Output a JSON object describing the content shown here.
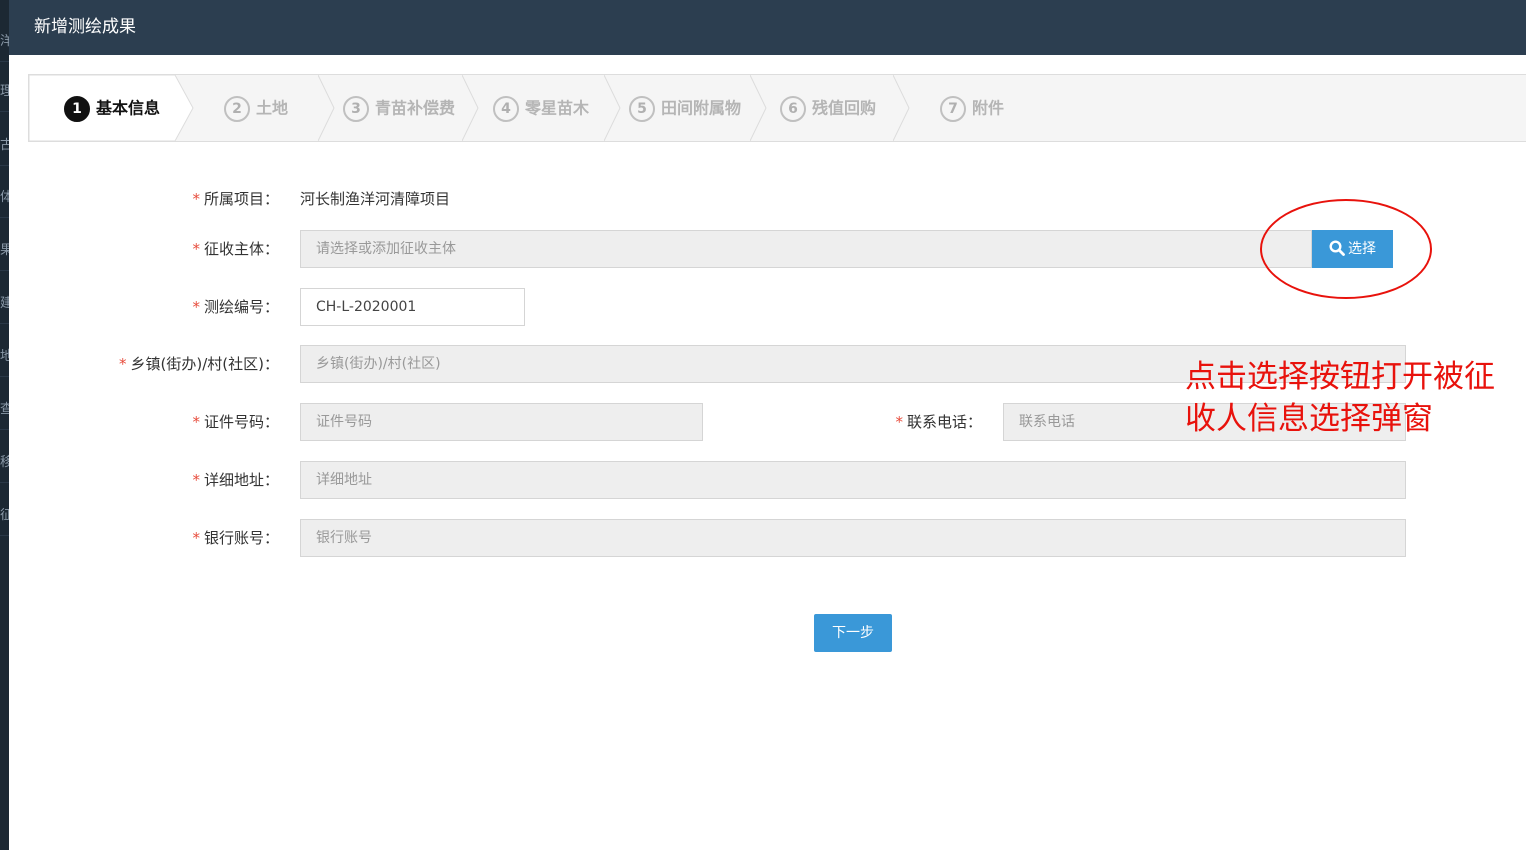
{
  "background": {
    "sidebar_fragments": [
      "洋",
      "理",
      "古",
      "体",
      "果",
      "建",
      "地",
      "查",
      "移",
      "征"
    ]
  },
  "modal": {
    "title": "新增测绘成果"
  },
  "steps": [
    {
      "number": "1",
      "label": "基本信息",
      "active": true
    },
    {
      "number": "2",
      "label": "土地",
      "active": false
    },
    {
      "number": "3",
      "label": "青苗补偿费",
      "active": false
    },
    {
      "number": "4",
      "label": "零星苗木",
      "active": false
    },
    {
      "number": "5",
      "label": "田间附属物",
      "active": false
    },
    {
      "number": "6",
      "label": "残值回购",
      "active": false
    },
    {
      "number": "7",
      "label": "附件",
      "active": false
    }
  ],
  "form": {
    "required_mark": "*",
    "project": {
      "label": "所属项目：",
      "value": "河长制渔洋河清障项目"
    },
    "subject": {
      "label": "征收主体：",
      "value": "",
      "placeholder": "请选择或添加征收主体"
    },
    "survey_no": {
      "label": "测绘编号：",
      "value": "CH-L-2020001",
      "placeholder": ""
    },
    "town": {
      "label": "乡镇(街办)/村(社区)：",
      "value": "",
      "placeholder": "乡镇(街办)/村(社区)"
    },
    "id_no": {
      "label": "证件号码：",
      "value": "",
      "placeholder": "证件号码"
    },
    "phone": {
      "label": "联系电话：",
      "value": "",
      "placeholder": "联系电话"
    },
    "address": {
      "label": "详细地址：",
      "value": "",
      "placeholder": "详细地址"
    },
    "bank": {
      "label": "银行账号：",
      "value": "",
      "placeholder": "银行账号"
    }
  },
  "buttons": {
    "select_label": "选择",
    "select_icon": "search-icon",
    "next_label": "下一步"
  },
  "colors": {
    "header_bg": "#2c3e50",
    "primary": "#3a98d8",
    "required": "#e74c3c",
    "annotation": "#e8120c"
  },
  "annotation": {
    "lines": [
      "点击选择按钮打开被征",
      "收人信息选择弹窗"
    ]
  }
}
